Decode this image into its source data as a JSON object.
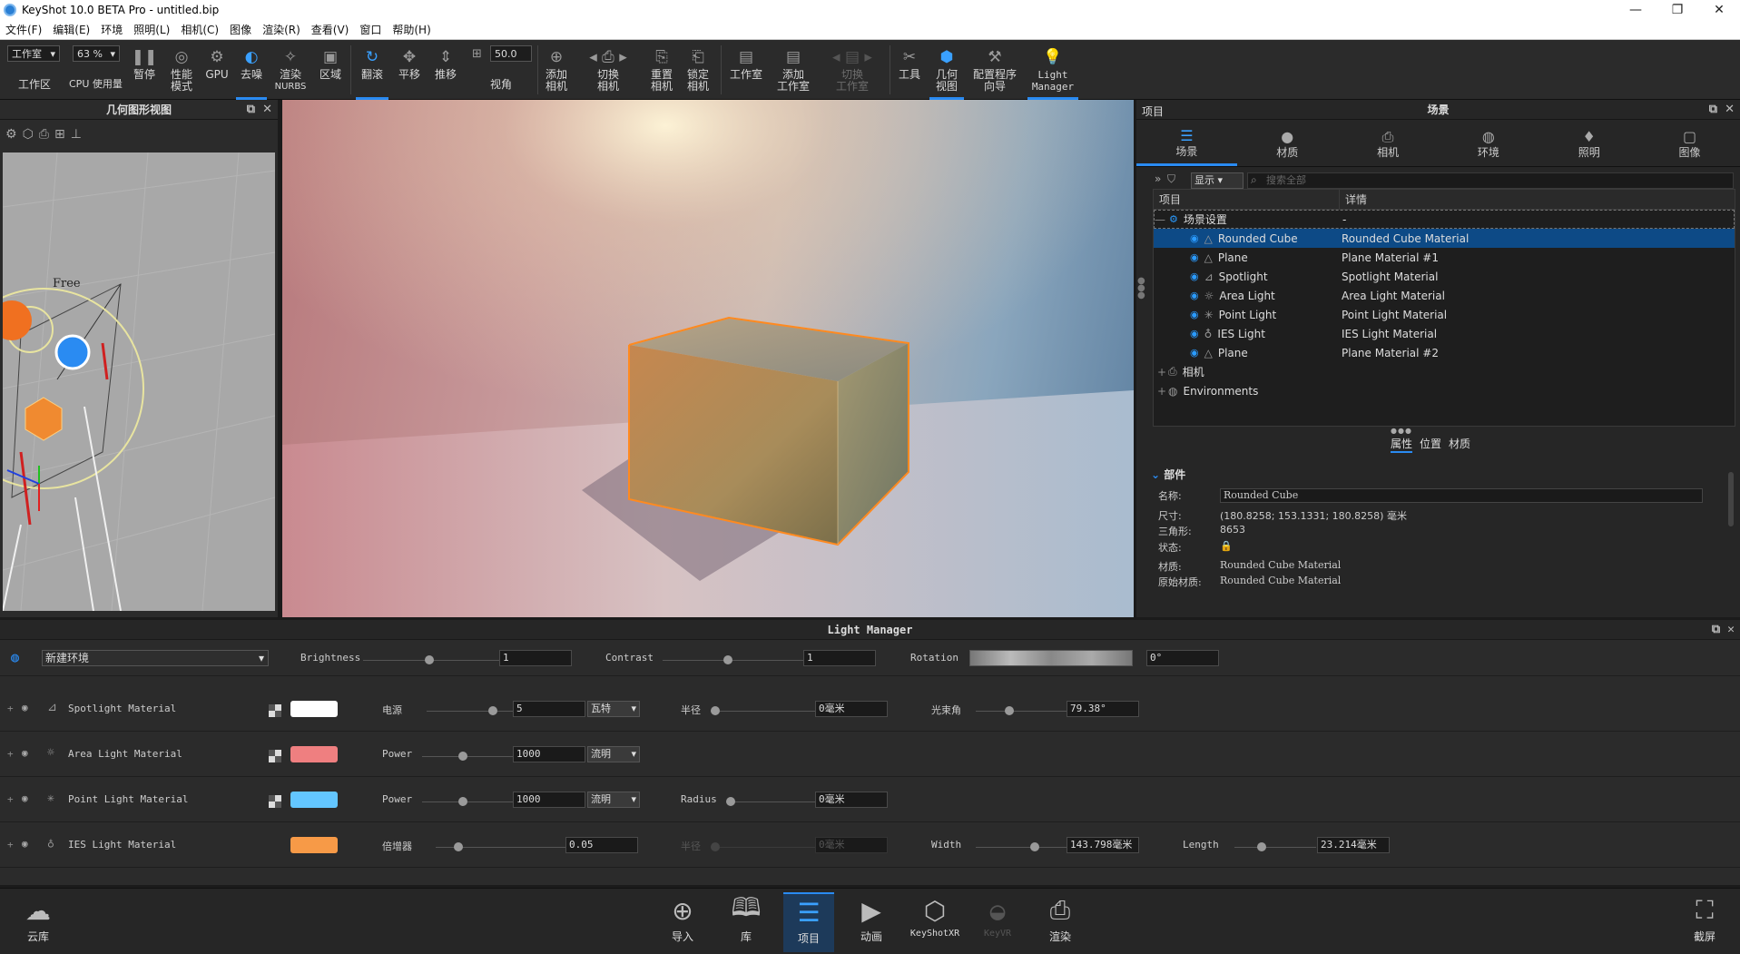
{
  "window": {
    "title": "KeyShot 10.0 BETA Pro  - untitled.bip",
    "min": "—",
    "max": "❐",
    "close": "✕"
  },
  "menu": [
    "文件(F)",
    "编辑(E)",
    "环境",
    "照明(L)",
    "相机(C)",
    "图像",
    "渲染(R)",
    "查看(V)",
    "窗口",
    "帮助(H)"
  ],
  "toolbar": {
    "workspace_select": "工作室",
    "workspace_label": "工作区",
    "cpu_value": "63 %",
    "cpu_label": "CPU 使用量",
    "pause": "暂停",
    "perf1": "性能",
    "perf2": "模式",
    "gpu": "GPU",
    "denoise": "去噪",
    "nurbs1": "渲染",
    "nurbs2": "NURBS",
    "region": "区域",
    "tumble": "翻滚",
    "pan": "平移",
    "dolly": "推移",
    "fov_value": "50.0",
    "fov_label": "视角",
    "addcam1": "添加",
    "addcam2": "相机",
    "switchcam1": "切换",
    "switchcam2": "相机",
    "resetcam1": "重置",
    "resetcam2": "相机",
    "lockcam1": "锁定",
    "lockcam2": "相机",
    "studio": "工作室",
    "addstudio1": "添加",
    "addstudio2": "工作室",
    "switchstudio1": "切换",
    "switchstudio2": "工作室",
    "tools": "工具",
    "geo1": "几何",
    "geo2": "视图",
    "wizard1": "配置程序",
    "wizard2": "向导",
    "lm1": "Light",
    "lm2": "Manager"
  },
  "geometry_view": {
    "title": "几何图形视图",
    "free_label": "Free"
  },
  "right_panel": {
    "project_label": "项目",
    "title": "场景",
    "tabs": [
      "场景",
      "材质",
      "相机",
      "环境",
      "照明",
      "图像"
    ],
    "display_dropdown": "显示",
    "search_placeholder": "搜索全部",
    "col_item": "项目",
    "col_detail": "详情",
    "scene_settings": "场景设置",
    "scene_settings_detail": "-",
    "items": [
      {
        "name": "Rounded Cube",
        "material": "Rounded Cube Material"
      },
      {
        "name": "Plane",
        "material": "Plane Material #1"
      },
      {
        "name": "Spotlight",
        "material": "Spotlight Material"
      },
      {
        "name": "Area Light",
        "material": "Area Light Material"
      },
      {
        "name": "Point Light",
        "material": "Point Light Material"
      },
      {
        "name": "IES Light",
        "material": "IES Light Material"
      },
      {
        "name": "Plane",
        "material": "Plane Material  #2"
      }
    ],
    "camera_group": "相机",
    "env_group": "Environments",
    "subtabs": [
      "属性",
      "位置",
      "材质"
    ],
    "part_header": "部件",
    "props": {
      "name_k": "名称:",
      "name_v": "Rounded Cube",
      "size_k": "尺寸:",
      "size_v": "(180.8258; 153.1331; 180.8258) 毫米",
      "tri_k": "三角形:",
      "tri_v": "8653",
      "state_k": "状态:",
      "mat_k": "材质:",
      "mat_v": "Rounded Cube Material",
      "orig_k": "原始材质:",
      "orig_v": "Rounded Cube Material"
    }
  },
  "light_manager": {
    "title": "Light Manager",
    "env_name": "新建环境",
    "brightness_label": "Brightness",
    "brightness_value": "1",
    "contrast_label": "Contrast",
    "contrast_value": "1",
    "rotation_label": "Rotation",
    "rotation_value": "0°",
    "lights": [
      {
        "name": "Spotlight Material",
        "color": "#ffffff",
        "p1_label": "电源",
        "p1_value": "5",
        "unit": "瓦特",
        "p2_label": "半径",
        "p2_value": "0毫米",
        "p3_label": "光束角",
        "p3_value": "79.38°"
      },
      {
        "name": "Area Light Material",
        "color": "#ef7f80",
        "p1_label": "Power",
        "p1_value": "1000",
        "unit": "流明"
      },
      {
        "name": "Point Light Material",
        "color": "#63c6ff",
        "p1_label": "Power",
        "p1_value": "1000",
        "unit": "流明",
        "p2_label": "Radius",
        "p2_value": "0毫米"
      },
      {
        "name": "IES Light Material",
        "color": "#f79a47",
        "p1_label": "倍增器",
        "p1_value": "0.05",
        "p2_label": "半径",
        "p2_value": "0毫米",
        "p3_label": "Width",
        "p3_value": "143.798毫米",
        "p4_label": "Length",
        "p4_value": "23.214毫米"
      }
    ]
  },
  "bottom": {
    "cloud": "云库",
    "import": "导入",
    "library": "库",
    "project": "项目",
    "animation": "动画",
    "keyshotxr": "KeyShotXR",
    "keyvr": "KeyVR",
    "render": "渲染",
    "screenshot": "截屏"
  }
}
